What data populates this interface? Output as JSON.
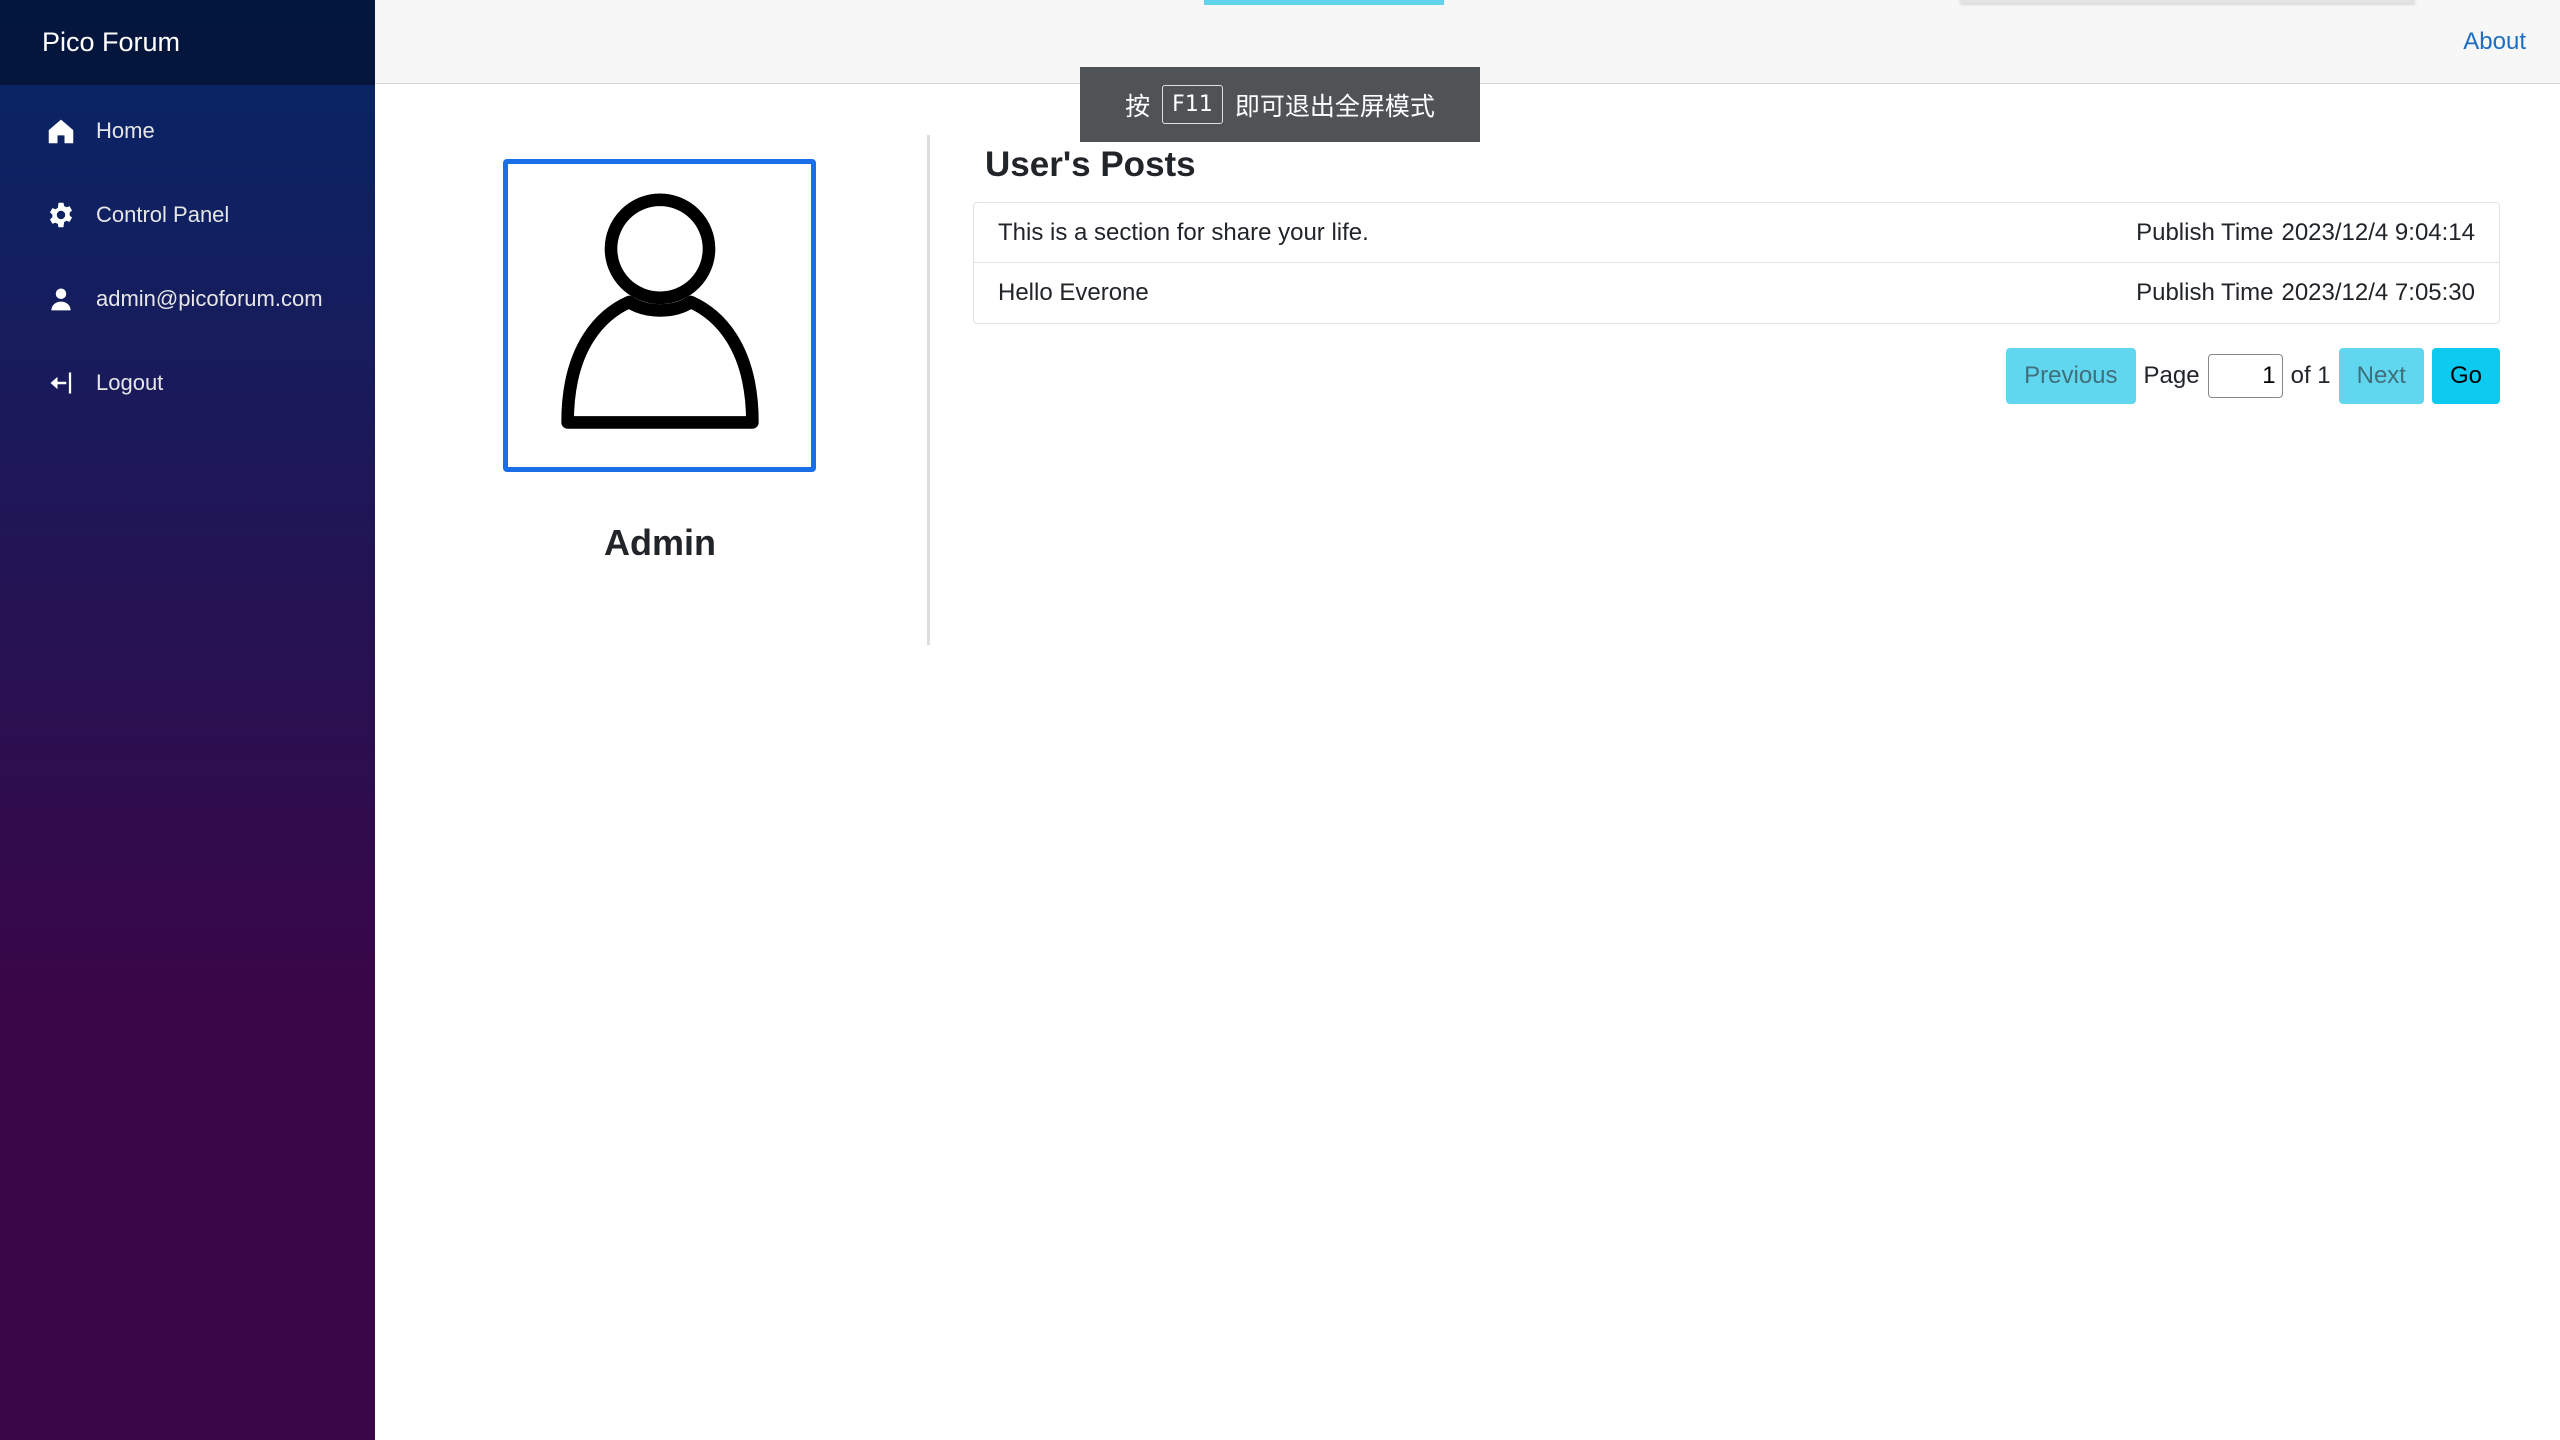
{
  "sidebar": {
    "brand": "Pico Forum",
    "items": [
      {
        "label": "Home",
        "icon": "home-icon"
      },
      {
        "label": "Control Panel",
        "icon": "gear-icon"
      },
      {
        "label": "admin@picoforum.com",
        "icon": "person-icon"
      },
      {
        "label": "Logout",
        "icon": "logout-arrow-icon"
      }
    ]
  },
  "topbar": {
    "about_label": "About"
  },
  "toast": {
    "prefix": "按",
    "key": "F11",
    "suffix": "即可退出全屏模式"
  },
  "profile": {
    "avatar_icon": "user-avatar-icon",
    "name": "Admin"
  },
  "posts": {
    "title": "User's Posts",
    "meta_label": "Publish Time",
    "items": [
      {
        "text": "This is a section for share your life.",
        "time": "2023/12/4 9:04:14"
      },
      {
        "text": "Hello Everone",
        "time": "2023/12/4 7:05:30"
      }
    ]
  },
  "pager": {
    "previous_label": "Previous",
    "page_label": "Page",
    "current_page": "1",
    "of_label": "of 1",
    "next_label": "Next",
    "go_label": "Go"
  },
  "colors": {
    "accent": "#1b6ec2",
    "avatar_border": "#1a6fe8",
    "go_button": "#0dcaf0",
    "disabled_button": "#61d7ef"
  }
}
